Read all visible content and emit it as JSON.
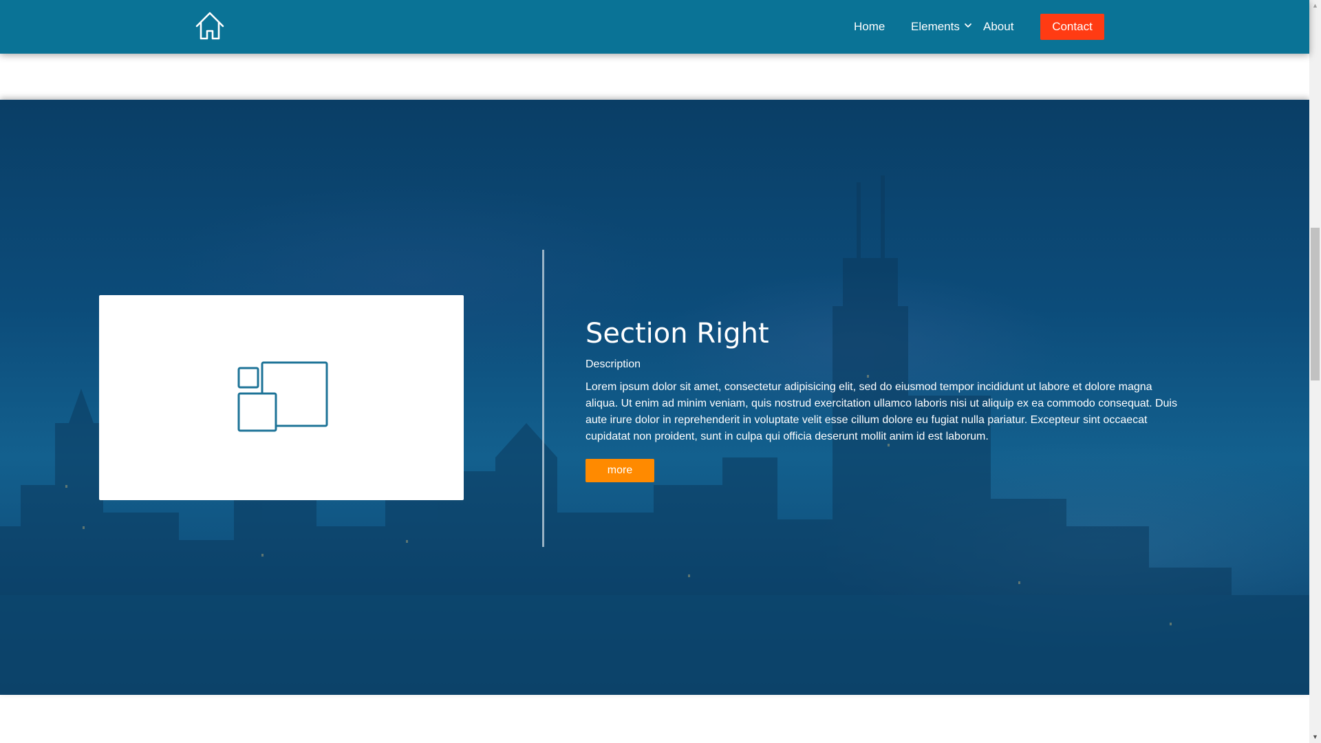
{
  "navbar": {
    "logo_icon": "home-icon",
    "links": {
      "home": "Home",
      "elements": "Elements",
      "about": "About"
    },
    "elements_dropdown_icon": "chevron-down-icon",
    "contact_label": "Contact"
  },
  "section": {
    "title": "Section Right",
    "subtitle": "Description",
    "body": "Lorem ipsum dolor sit amet, consectetur adipisicing elit, sed do eiusmod tempor incididunt ut labore et dolore magna aliqua. Ut enim ad minim veniam, quis nostrud exercitation ullamco laboris nisi ut aliquip ex ea commodo consequat. Duis aute irure dolor in reprehenderit in voluptate velit esse cillum dolore eu fugiat nulla pariatur. Excepteur sint occaecat cupidatat non proident, sunt in culpa qui officia deserunt mollit anim id est laborum.",
    "button_label": "more",
    "image_placeholder_icon": "image-placeholder-icon",
    "background": "city-skyline-night"
  },
  "colors": {
    "navbar_bg": "#0a7396",
    "contact_button": "#ff3b13",
    "more_button": "#ff8a00",
    "icon_stroke": "#1d7397",
    "overlay": "#0c4c7a"
  }
}
